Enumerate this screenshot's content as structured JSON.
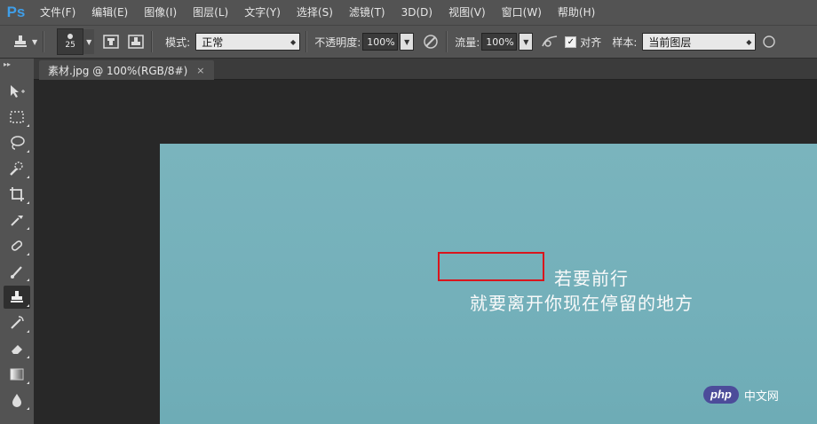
{
  "app": {
    "logo": "Ps"
  },
  "menu": [
    "文件(F)",
    "编辑(E)",
    "图像(I)",
    "图层(L)",
    "文字(Y)",
    "选择(S)",
    "滤镜(T)",
    "3D(D)",
    "视图(V)",
    "窗口(W)",
    "帮助(H)"
  ],
  "options": {
    "brush_size": "25",
    "mode_label": "模式:",
    "mode_value": "正常",
    "opacity_label": "不透明度:",
    "opacity_value": "100%",
    "flow_label": "流量:",
    "flow_value": "100%",
    "aligned_label": "对齐",
    "aligned_checked": "✓",
    "sample_label": "样本:",
    "sample_value": "当前图层"
  },
  "document": {
    "tab_title": "素材.jpg @ 100%(RGB/8#)",
    "close": "×"
  },
  "image": {
    "line1": "若要前行",
    "line2": "就要离开你现在停留的地方"
  },
  "watermark": {
    "badge": "php",
    "text": "中文网"
  },
  "colors": {
    "accent": "#3f9ee8",
    "highlight_box": "#d9151c",
    "image_bg": "#76b1bb"
  },
  "tools": [
    "move-icon",
    "marquee-icon",
    "lasso-icon",
    "quick-select-icon",
    "crop-icon",
    "eyedropper-icon",
    "healing-brush-icon",
    "brush-icon",
    "clone-stamp-icon",
    "history-brush-icon",
    "eraser-icon",
    "gradient-icon",
    "blur-icon"
  ]
}
